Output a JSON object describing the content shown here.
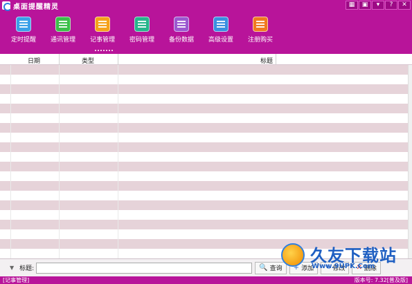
{
  "window": {
    "title": "桌面提醒精灵",
    "buttons": [
      "▦",
      "▣",
      "▾",
      "?",
      "✕"
    ]
  },
  "toolbar": {
    "items": [
      {
        "label": "定时提醒",
        "icon": "alarm-clock-icon",
        "color": "#3aa0e8"
      },
      {
        "label": "通讯管理",
        "icon": "contacts-icon",
        "color": "#3cbf4a"
      },
      {
        "label": "记事管理",
        "icon": "notepad-icon",
        "color": "#f5a21a"
      },
      {
        "label": "密码管理",
        "icon": "password-icon",
        "color": "#27b58c"
      },
      {
        "label": "备份数据",
        "icon": "backup-icon",
        "color": "#9b59d0"
      },
      {
        "label": "高级设置",
        "icon": "settings-icon",
        "color": "#3a8fe0"
      },
      {
        "label": "注册购买",
        "icon": "register-icon",
        "color": "#f07a20"
      }
    ],
    "active": "记事管理"
  },
  "grid": {
    "columns": [
      "日期",
      "类型",
      "标题"
    ],
    "row_count": 20
  },
  "search": {
    "label": "标题:",
    "value": "",
    "query_button": "查询",
    "add_button": "添加",
    "edit_button": "修改",
    "delete_button": "删除"
  },
  "status": {
    "left": "[记事管理]",
    "right": "版本号: 7.32[普及版]"
  },
  "watermark": {
    "text": "久友下载站",
    "url": "Www.9UPK.Com"
  }
}
